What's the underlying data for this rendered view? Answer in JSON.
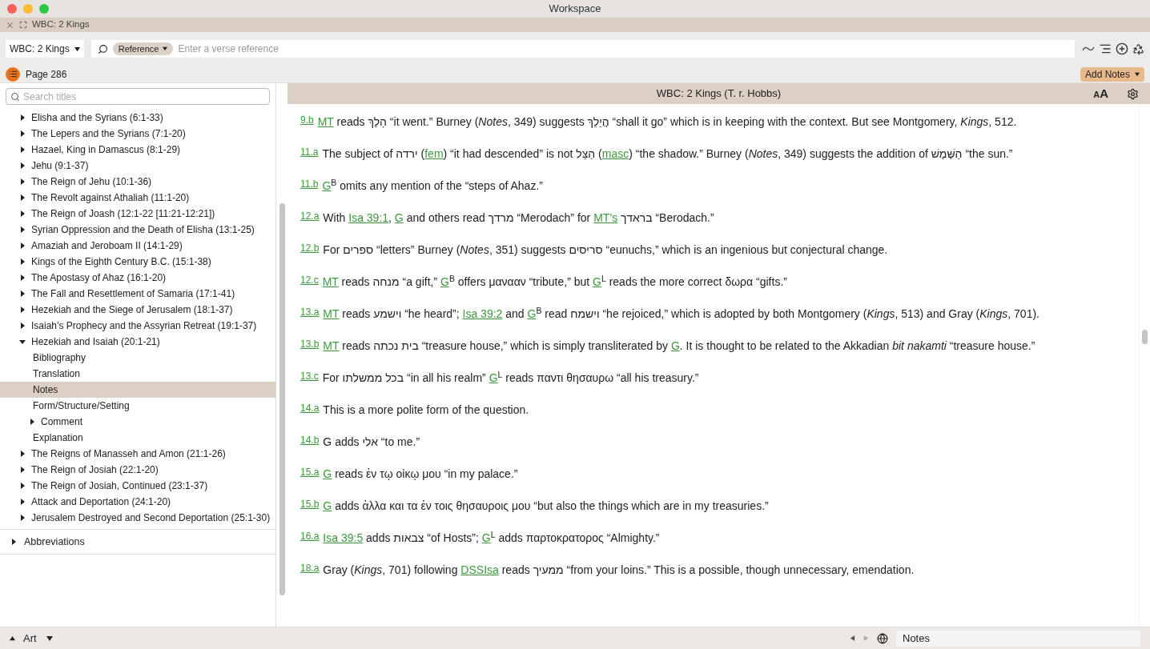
{
  "window": {
    "title": "Workspace"
  },
  "tab": {
    "label": "WBC: 2 Kings"
  },
  "toolbar": {
    "resource": "WBC: 2 Kings",
    "search_type": "Reference",
    "search_placeholder": "Enter a verse reference"
  },
  "page_bar": {
    "page": "Page 286",
    "add_notes": "Add Notes"
  },
  "sidebar": {
    "search_placeholder": "Search titles",
    "items": [
      {
        "label": "Elisha and the Syrians (6:1-33)",
        "expanded": false,
        "selected": false
      },
      {
        "label": "The Lepers and the Syrians (7:1-20)",
        "expanded": false,
        "selected": false
      },
      {
        "label": "Hazael, King in Damascus (8:1-29)",
        "expanded": false,
        "selected": false
      },
      {
        "label": "Jehu (9:1-37)",
        "expanded": false,
        "selected": false
      },
      {
        "label": "The Reign of Jehu (10:1-36)",
        "expanded": false,
        "selected": false
      },
      {
        "label": "The Revolt against Athaliah (11:1-20)",
        "expanded": false,
        "selected": false
      },
      {
        "label": "The Reign of Joash (12:1-22 [11:21-12:21])",
        "expanded": false,
        "selected": false
      },
      {
        "label": "Syrian Oppression and the Death of Elisha (13:1-25)",
        "expanded": false,
        "selected": false
      },
      {
        "label": "Amaziah and Jeroboam II (14:1-29)",
        "expanded": false,
        "selected": false
      },
      {
        "label": "Kings of the Eighth Century B.C.  (15:1-38)",
        "expanded": false,
        "selected": false
      },
      {
        "label": "The Apostasy of Ahaz (16:1-20)",
        "expanded": false,
        "selected": false
      },
      {
        "label": "The Fall and Resettlement of Samaria (17:1-41)",
        "expanded": false,
        "selected": false
      },
      {
        "label": "Hezekiah and the Siege of Jerusalem (18:1-37)",
        "expanded": false,
        "selected": false
      },
      {
        "label": "Isaiah’s Prophecy and the Assyrian Retreat (19:1-37)",
        "expanded": false,
        "selected": false
      },
      {
        "label": "Hezekiah and Isaiah (20:1-21)",
        "expanded": true,
        "selected": false,
        "children": [
          {
            "label": "Bibliography",
            "selected": false
          },
          {
            "label": "Translation",
            "selected": false
          },
          {
            "label": "Notes",
            "selected": true
          },
          {
            "label": "Form/Structure/Setting",
            "selected": false
          },
          {
            "label": "Comment",
            "expanded": false,
            "selected": false
          },
          {
            "label": "Explanation",
            "selected": false
          }
        ]
      },
      {
        "label": "The Reigns of Manasseh and Amon (21:1-26)",
        "expanded": false,
        "selected": false
      },
      {
        "label": "The Reign of Josiah (22:1-20)",
        "expanded": false,
        "selected": false
      },
      {
        "label": "The Reign of Josiah, Continued (23:1-37)",
        "expanded": false,
        "selected": false
      },
      {
        "label": "Attack and Deportation (24:1-20)",
        "expanded": false,
        "selected": false
      },
      {
        "label": "Jerusalem Destroyed and Second Deportation (25:1-30)",
        "expanded": false,
        "selected": false
      }
    ],
    "footer_items": [
      {
        "label": "Abbreviations",
        "expanded": false,
        "selected": false
      }
    ]
  },
  "content": {
    "title": "WBC: 2 Kings (T. r. Hobbs)",
    "font_size_button": "AA",
    "notes": [
      {
        "ref": "9.b",
        "parts": [
          {
            "kind": "link",
            "text": "MT"
          },
          {
            "kind": "text",
            "text": " reads הָלַךְ “it went.” Burney (*Notes*, 349) suggests הֲיֵלֵךְ “shall it go” which is in keeping with the context. But see Montgomery, *Kings*, 512."
          }
        ]
      },
      {
        "ref": "11.a",
        "parts": [
          {
            "kind": "text",
            "text": "The subject of ירדה ("
          },
          {
            "kind": "link",
            "text": "fem"
          },
          {
            "kind": "text",
            "text": ") “it had descended” is not הַצֵּל ("
          },
          {
            "kind": "link",
            "text": "masc"
          },
          {
            "kind": "text",
            "text": ") “the shadow.” Burney (*Notes*, 349) suggests the addition of הַשֶּׁמֶשׁ “the sun.”"
          }
        ]
      },
      {
        "ref": "11.b",
        "parts": [
          {
            "kind": "link",
            "text": "G"
          },
          {
            "kind": "text",
            "text": "$^{B}$ omits any mention of the “steps of Ahaz.”"
          }
        ]
      },
      {
        "ref": "12.a",
        "parts": [
          {
            "kind": "text",
            "text": "With "
          },
          {
            "kind": "link",
            "text": "Isa 39:1"
          },
          {
            "kind": "text",
            "text": ", "
          },
          {
            "kind": "link",
            "text": "G"
          },
          {
            "kind": "text",
            "text": " and others read מרדך “Merodach” for "
          },
          {
            "kind": "link",
            "text": "MT’s"
          },
          {
            "kind": "text",
            "text": " בראדך “Berodach.”"
          }
        ]
      },
      {
        "ref": "12.b",
        "parts": [
          {
            "kind": "text",
            "text": "For ספרים “letters” Burney (*Notes*, 351) suggests סריסים “eunuchs,” which is an ingenious but conjectural change."
          }
        ]
      },
      {
        "ref": "12.c",
        "parts": [
          {
            "kind": "link",
            "text": "MT"
          },
          {
            "kind": "text",
            "text": " reads מנחה “a gift,” "
          },
          {
            "kind": "link",
            "text": "G"
          },
          {
            "kind": "text",
            "text": "$^{B}$ offers μανααν “tribute,” but "
          },
          {
            "kind": "link",
            "text": "G"
          },
          {
            "kind": "text",
            "text": "$^{L}$ reads the more correct δωρα “gifts.”"
          }
        ]
      },
      {
        "ref": "13.a",
        "parts": [
          {
            "kind": "link",
            "text": "MT"
          },
          {
            "kind": "text",
            "text": " reads וישמע “he heard”; "
          },
          {
            "kind": "link",
            "text": "Isa 39:2"
          },
          {
            "kind": "text",
            "text": " and "
          },
          {
            "kind": "link",
            "text": "G"
          },
          {
            "kind": "text",
            "text": "$^{B}$ read וישמח “he rejoiced,” which is adopted by both Montgomery (*Kings*, 513) and Gray (*Kings*, 701)."
          }
        ]
      },
      {
        "ref": "13.b",
        "parts": [
          {
            "kind": "link",
            "text": "MT"
          },
          {
            "kind": "text",
            "text": " reads בית נכתה “treasure house,” which is simply transliterated by "
          },
          {
            "kind": "link",
            "text": "G"
          },
          {
            "kind": "text",
            "text": ". It is thought to be related to the Akkadian *bit nakamti* “treasure house.”"
          }
        ]
      },
      {
        "ref": "13.c",
        "parts": [
          {
            "kind": "text",
            "text": "For בכל ממשלתו “in all his realm” "
          },
          {
            "kind": "link",
            "text": "G"
          },
          {
            "kind": "text",
            "text": "$^{L}$ reads παντι θησαυρω “all his treasury.”"
          }
        ]
      },
      {
        "ref": "14.a",
        "parts": [
          {
            "kind": "text",
            "text": "This is a more polite form of the question."
          }
        ]
      },
      {
        "ref": "14.b",
        "parts": [
          {
            "kind": "text",
            "text": "G adds אלי “to me.”"
          }
        ]
      },
      {
        "ref": "15.a",
        "parts": [
          {
            "kind": "link",
            "text": "G"
          },
          {
            "kind": "text",
            "text": " reads ἐν τῳ οἰκῳ μου “in my palace.”"
          }
        ]
      },
      {
        "ref": "15.b",
        "parts": [
          {
            "kind": "link",
            "text": "G"
          },
          {
            "kind": "text",
            "text": " adds ἀλλα και τα ἐν τοις θησαυροις μου “but also the things which are in my treasuries.”"
          }
        ]
      },
      {
        "ref": "16.a",
        "parts": [
          {
            "kind": "link",
            "text": "Isa 39:5"
          },
          {
            "kind": "text",
            "text": " adds צבאות “of Hosts”; "
          },
          {
            "kind": "link",
            "text": "G"
          },
          {
            "kind": "text",
            "text": "$^{L}$ adds παρτοκρατορος “Almighty.”"
          }
        ]
      },
      {
        "ref": "18.a",
        "parts": [
          {
            "kind": "text",
            "text": "Gray (*Kings*, 701) following "
          },
          {
            "kind": "link",
            "text": "DSSIsa"
          },
          {
            "kind": "text",
            "text": " reads ממעיך “from your loins.” This is a possible, though unnecessary, emendation."
          }
        ]
      }
    ]
  },
  "status_bar": {
    "layout": "Art",
    "location": "Notes"
  }
}
